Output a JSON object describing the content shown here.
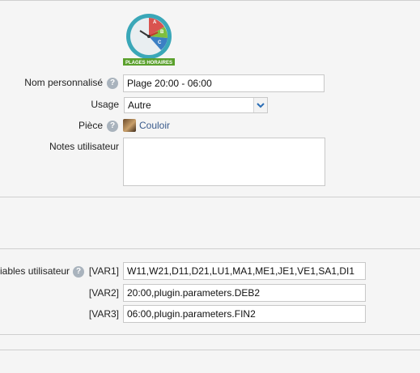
{
  "plugin": {
    "logo_text": "PLAGES HORAIRES",
    "logo_letters": [
      "A",
      "B",
      "C"
    ],
    "icon": "clock-abc-icon"
  },
  "form": {
    "custom_name": {
      "label": "Nom personnalisé",
      "value": "Plage 20:00 - 06:00"
    },
    "usage": {
      "label": "Usage",
      "value": "Autre"
    },
    "room": {
      "label": "Pièce",
      "value": "Couloir",
      "icon": "room-photo-icon"
    },
    "notes": {
      "label": "Notes utilisateur",
      "value": ""
    }
  },
  "variables": {
    "label": "iables utilisateur",
    "rows": [
      {
        "key": "[VAR1]",
        "value": "W11,W21,D11,D21,LU1,MA1,ME1,JE1,VE1,SA1,DI1"
      },
      {
        "key": "[VAR2]",
        "value": "20:00,plugin.parameters.DEB2"
      },
      {
        "key": "[VAR3]",
        "value": "06:00,plugin.parameters.FIN2"
      }
    ]
  },
  "help_glyph": "?",
  "colors": {
    "link": "#3a5b8c",
    "logo_green": "#5aa02c",
    "logo_teal": "#3aa7b8"
  }
}
